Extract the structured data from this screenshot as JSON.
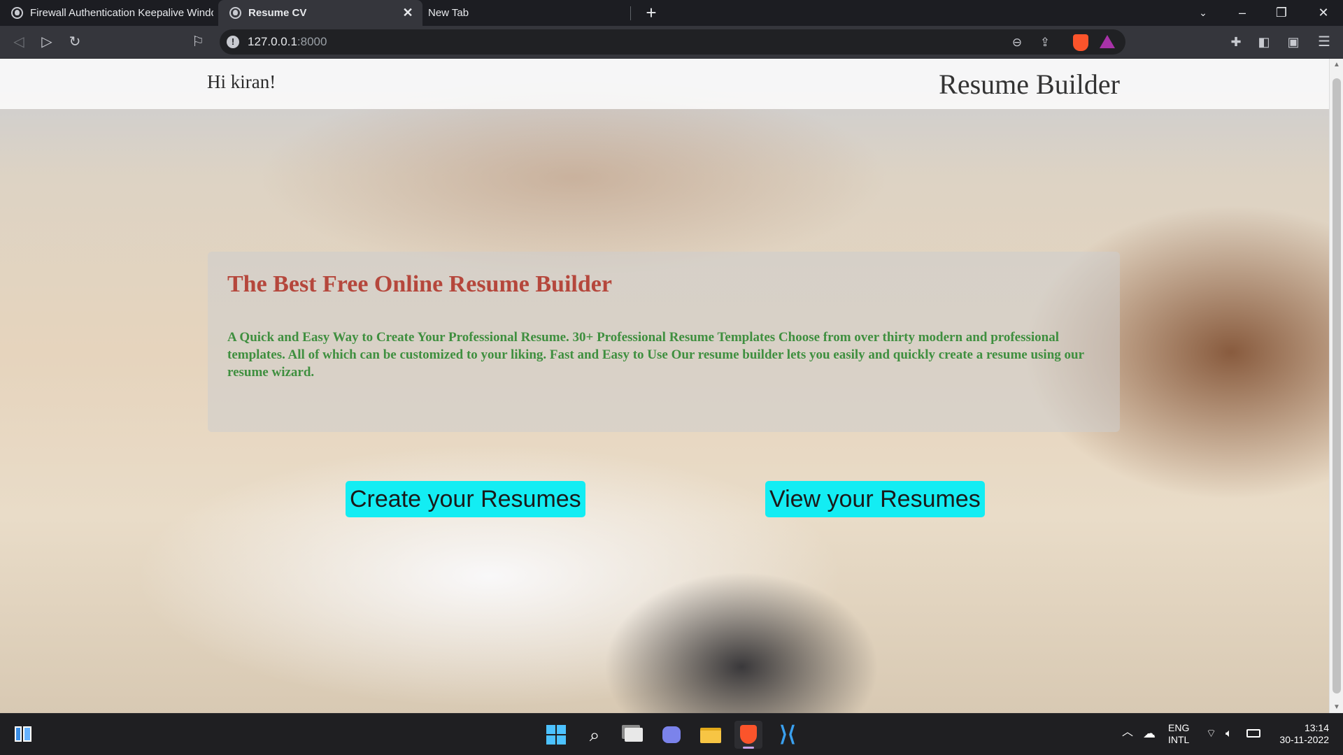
{
  "browser": {
    "tabs": [
      {
        "title": "Firewall Authentication Keepalive Window"
      },
      {
        "title": "Resume CV",
        "active": true
      },
      {
        "title": "New Tab"
      }
    ],
    "url_host": "127.0.0.1",
    "url_port": ":8000"
  },
  "page": {
    "greeting": "Hi kiran!",
    "brand": "Resume Builder",
    "hero_title": "The Best Free Online Resume Builder",
    "hero_description": "A Quick and Easy Way to Create Your Professional Resume. 30+ Professional Resume Templates Choose from over thirty modern and professional templates. All of which can be customized to your liking. Fast and Easy to Use Our resume builder lets you easily and quickly create a resume using our resume wizard.",
    "create_button": "Create your Resumes",
    "view_button": "View your Resumes",
    "colors": {
      "hero_title": "#b5473c",
      "hero_text": "#3f8f3f",
      "cta_background": "#13edf3"
    }
  },
  "taskbar": {
    "language": "ENG",
    "layout": "INTL",
    "time": "13:14",
    "date": "30-11-2022"
  }
}
